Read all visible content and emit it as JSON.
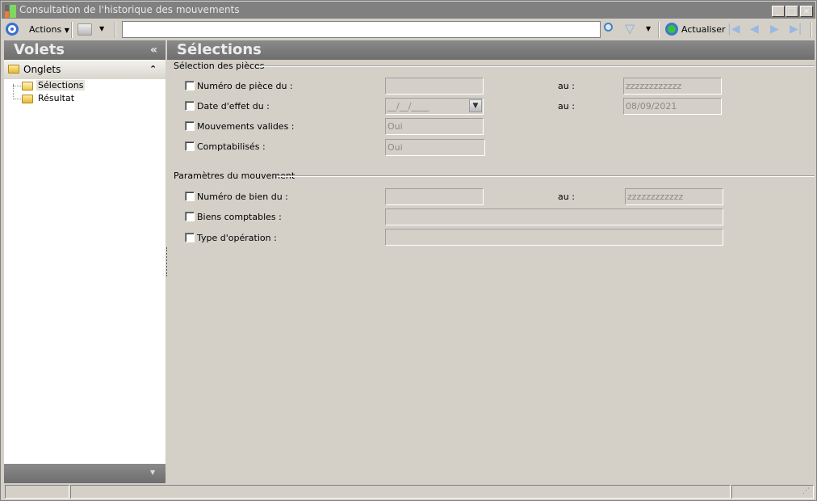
{
  "window": {
    "title": "Consultation de l'historique des mouvements",
    "minimize": "_",
    "maximize": "□",
    "close": "×"
  },
  "toolbar": {
    "actions_label": "Actions",
    "search_value": "",
    "refresh_label": "Actualiser"
  },
  "left_pane": {
    "title": "Volets",
    "collapse": "«",
    "section": "Onglets",
    "section_toggle": "⌃",
    "items": [
      {
        "label": "Sélections",
        "selected": true
      },
      {
        "label": "Résultat",
        "selected": false
      }
    ]
  },
  "main": {
    "title": "Sélections",
    "group1": {
      "title": "Sélection des pièces",
      "rows": [
        {
          "label": "Numéro de pièce du :",
          "from": "",
          "to_label": "au :",
          "to": "zzzzzzzzzzzz"
        },
        {
          "label": "Date d'effet du :",
          "from": "__/__/____",
          "to_label": "au :",
          "to": "08/09/2021"
        },
        {
          "label": "Mouvements valides :",
          "from": "Oui"
        },
        {
          "label": "Comptabilisés :",
          "from": "Oui"
        }
      ]
    },
    "group2": {
      "title": "Paramètres du mouvement",
      "rows": [
        {
          "label": "Numéro de bien du :",
          "from": "",
          "to_label": "au :",
          "to": "zzzzzzzzzzzz"
        },
        {
          "label": "Biens comptables :",
          "from": ""
        },
        {
          "label": "Type d'opération :",
          "from": ""
        }
      ]
    }
  }
}
